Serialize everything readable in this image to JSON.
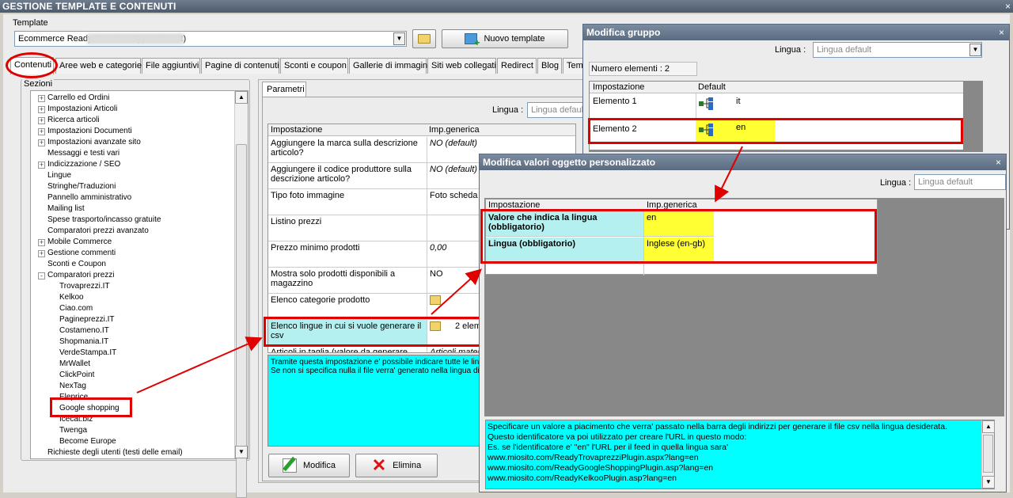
{
  "window": {
    "title": "GESTIONE TEMPLATE E CONTENUTI",
    "close": "×"
  },
  "template": {
    "label": "Template",
    "value": "Ecommerce Ready Pro d                    .readyprodemo.it)",
    "new_button": "Nuovo template"
  },
  "tabs": [
    "Contenuti",
    "Aree web e categorie",
    "File aggiuntivi",
    "Pagine di contenuti",
    "Sconti e coupon",
    "Gallerie di immagini",
    "Siti web collegati",
    "Redirect",
    "Blog",
    "Tem"
  ],
  "sections": {
    "label": "Sezioni",
    "items": [
      {
        "label": "Carrello ed Ordini",
        "exp": "+"
      },
      {
        "label": "Impostazioni Articoli",
        "exp": "+"
      },
      {
        "label": "Ricerca articoli",
        "exp": "+"
      },
      {
        "label": "Impostazioni Documenti",
        "exp": "+"
      },
      {
        "label": "Impostazioni avanzate sito",
        "exp": "+"
      },
      {
        "label": "Messaggi e testi vari",
        "exp": ""
      },
      {
        "label": "Indicizzazione / SEO",
        "exp": "+"
      },
      {
        "label": "Lingue",
        "exp": ""
      },
      {
        "label": "Stringhe/Traduzioni",
        "exp": ""
      },
      {
        "label": "Pannello amministrativo",
        "exp": ""
      },
      {
        "label": "Mailing list",
        "exp": ""
      },
      {
        "label": "Spese trasporto/incasso gratuite",
        "exp": ""
      },
      {
        "label": "Comparatori prezzi avanzato",
        "exp": ""
      },
      {
        "label": "Mobile Commerce",
        "exp": "+"
      },
      {
        "label": "Gestione commenti",
        "exp": "+"
      },
      {
        "label": "Sconti e Coupon",
        "exp": ""
      },
      {
        "label": "Comparatori prezzi",
        "exp": "-"
      }
    ],
    "sub_items": [
      "Trovaprezzi.IT",
      "Kelkoo",
      "Ciao.com",
      "Pagineprezzi.IT",
      "Costameno.IT",
      "Shopmania.IT",
      "VerdeStampa.IT",
      "MrWallet",
      "ClickPoint",
      "NexTag",
      "Eleprice",
      "Google shopping",
      "Icecat.biz",
      "Twenga",
      "Become Europe"
    ],
    "last_item": "Richieste degli utenti (testi delle email)"
  },
  "params": {
    "tab": "Parametri",
    "lingua_label": "Lingua :",
    "lingua_value": "Lingua default",
    "col_setting": "Impostazione",
    "col_value": "Imp.generica",
    "rows": [
      {
        "setting": "Aggiungere la marca sulla descrizione articolo?",
        "value": "NO (default)"
      },
      {
        "setting": "Aggiungere il codice produttore sulla descrizione articolo?",
        "value": "NO (default)"
      },
      {
        "setting": "Tipo foto immagine",
        "value": "Foto scheda"
      },
      {
        "setting": "Listino prezzi",
        "value": ""
      },
      {
        "setting": "Prezzo minimo prodotti",
        "value": "0,00"
      },
      {
        "setting": "Mostra solo prodotti disponibili a magazzino",
        "value": "NO"
      },
      {
        "setting": "Elenco categorie prodotto",
        "value": ""
      },
      {
        "setting": "Elenco lingue in cui si vuole generare il csv",
        "value": "2 elem"
      },
      {
        "setting": "Articoli in taglia (valore da generare",
        "value": "Articoli mater"
      }
    ],
    "description": "Tramite questa impostazione e' possibile indicare tutte le ling\nSe non si specifica nulla il file verra' generato nella lingua di",
    "modify_button": "Modifica",
    "delete_button": "Elimina"
  },
  "group_dialog": {
    "title": "Modifica gruppo",
    "close": "×",
    "lingua_label": "Lingua :",
    "lingua_value": "Lingua default",
    "count": "Numero elementi : 2",
    "col_setting": "Impostazione",
    "col_default": "Default",
    "rows": [
      {
        "label": "Elemento 1",
        "value": "it"
      },
      {
        "label": "Elemento 2",
        "value": "en"
      }
    ]
  },
  "values_dialog": {
    "title": "Modifica valori oggetto personalizzato",
    "close": "×",
    "lingua_label": "Lingua :",
    "lingua_value": "Lingua default",
    "col_setting": "Impostazione",
    "col_value": "Imp.generica",
    "rows": [
      {
        "setting": "Valore che indica la lingua (obbligatorio)",
        "value": "en"
      },
      {
        "setting": "Lingua (obbligatorio)",
        "value": "Inglese (en-gb)"
      }
    ],
    "description": [
      "Specificare un valore a piacimento che verra' passato nella barra degli indirizzi per generare il file csv nella lingua desiderata.",
      "Questo identificatore va poi utilizzato per creare l'URL in questo modo:",
      "Es. se l'identificatore e'  \"en\" l'URL per il feed in quella lingua sara'",
      "www.miosito.com/ReadyTrovaprezziPlugin.aspx?lang=en",
      "www.miosito.com/ReadyGoogleShoppingPlugin.asp?lang=en",
      "www.miosito.com/ReadyKelkooPlugin.asp?lang=en"
    ]
  },
  "colors": {
    "highlight_red": "#e00000",
    "cyan": "#00ffff",
    "yellow": "#ffff33"
  }
}
